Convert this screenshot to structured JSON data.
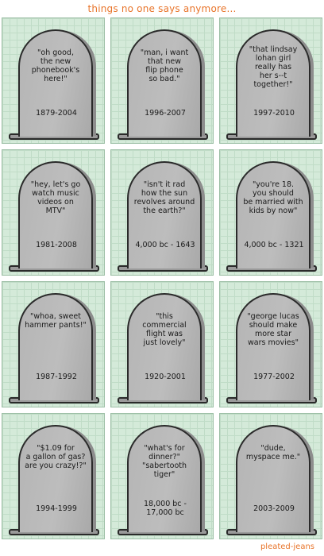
{
  "title": "things no one says anymore...",
  "credit": "pleated-jeans",
  "colors": {
    "title": "#e8742a",
    "cell_background": "#d4ead9",
    "stone": "#b5b5b5"
  },
  "tombstones": [
    {
      "quote": "\"oh good,\nthe new\nphonebook's\nhere!\"",
      "dates": "1879-2004"
    },
    {
      "quote": "\"man, i want\nthat new\nflip phone\nso bad.\"",
      "dates": "1996-2007"
    },
    {
      "quote": "\"that lindsay\nlohan girl\nreally has\nher s--t\ntogether!\"",
      "dates": "1997-2010"
    },
    {
      "quote": "\"hey, let's go\nwatch music\nvideos on\nMTV\"",
      "dates": "1981-2008"
    },
    {
      "quote": "\"isn't it rad\nhow the sun\nrevolves around\nthe earth?\"",
      "dates": "4,000 bc - 1643"
    },
    {
      "quote": "\"you're 18.\nyou should\nbe married with\nkids by now\"",
      "dates": "4,000 bc - 1321"
    },
    {
      "quote": "\"whoa, sweet\nhammer pants!\"",
      "dates": "1987-1992"
    },
    {
      "quote": "\"this\ncommercial\nflight was\njust lovely\"",
      "dates": "1920-2001"
    },
    {
      "quote": "\"george lucas\nshould make\nmore star\nwars movies\"",
      "dates": "1977-2002"
    },
    {
      "quote": "\"$1.09 for\na gallon of gas?\nare you crazy!?\"",
      "dates": "1994-1999"
    },
    {
      "quote": "\"what's for\ndinner?\"\n\"sabertooth\ntiger\"",
      "dates": "18,000 bc -\n17,000 bc"
    },
    {
      "quote": "\"dude,\nmyspace me.\"",
      "dates": "2003-2009"
    }
  ]
}
